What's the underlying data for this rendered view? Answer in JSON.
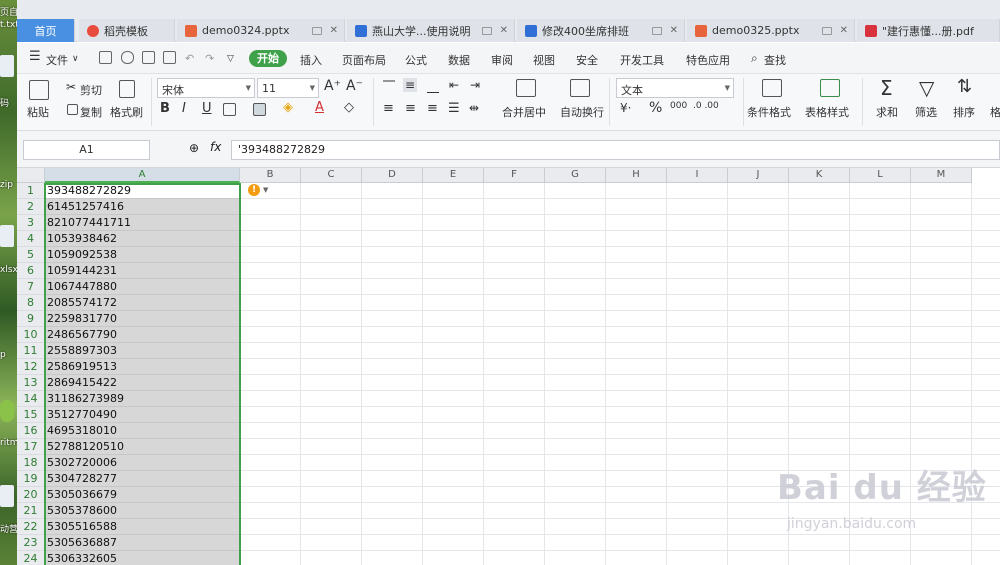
{
  "desktop": {
    "labels": [
      "页自",
      "t.txt",
      "码",
      "zip",
      "xlsx",
      "p",
      "ritm",
      "动营"
    ]
  },
  "tabs": [
    {
      "label": "首页",
      "active": true
    },
    {
      "label": "稻壳模板",
      "icon_color": "#e84c3d"
    },
    {
      "label": "demo0324.pptx",
      "icon_color": "#e8643c"
    },
    {
      "label": "燕山大学...使用说明",
      "icon_color": "#2f6fd6"
    },
    {
      "label": "修改400坐席排班",
      "icon_color": "#2f6fd6"
    },
    {
      "label": "demo0325.pptx",
      "icon_color": "#e8643c"
    },
    {
      "label": "\"建行惠懂...册.pdf",
      "icon_color": "#d8323c"
    }
  ],
  "menu": {
    "file_label": "文件",
    "start_label": "开始",
    "items": [
      "插入",
      "页面布局",
      "公式",
      "数据",
      "审阅",
      "视图",
      "安全",
      "开发工具",
      "特色应用"
    ],
    "search_label": "查找"
  },
  "ribbon": {
    "paste": "粘贴",
    "cut": "剪切",
    "copy": "复制",
    "format_painter": "格式刷",
    "font_name": "宋体",
    "font_size": "11",
    "merge_center": "合并居中",
    "wrap_text": "自动换行",
    "number_format": "文本",
    "conditional_format": "条件格式",
    "table_style": "表格样式",
    "sum": "求和",
    "filter": "筛选",
    "sort": "排序",
    "format": "格"
  },
  "formula_bar": {
    "name_box": "A1",
    "fx_label": "fx",
    "value": "'393488272829"
  },
  "columns": [
    "A",
    "B",
    "C",
    "D",
    "E",
    "F",
    "G",
    "H",
    "I",
    "J",
    "K",
    "L",
    "M"
  ],
  "rows": [
    {
      "n": "1",
      "a": "393488272829"
    },
    {
      "n": "2",
      "a": "61451257416"
    },
    {
      "n": "3",
      "a": "821077441711"
    },
    {
      "n": "4",
      "a": "1053938462"
    },
    {
      "n": "5",
      "a": "1059092538"
    },
    {
      "n": "6",
      "a": "1059144231"
    },
    {
      "n": "7",
      "a": "1067447880"
    },
    {
      "n": "8",
      "a": "2085574172"
    },
    {
      "n": "9",
      "a": "2259831770"
    },
    {
      "n": "10",
      "a": "2486567790"
    },
    {
      "n": "11",
      "a": "2558897303"
    },
    {
      "n": "12",
      "a": "2586919513"
    },
    {
      "n": "13",
      "a": "2869415422"
    },
    {
      "n": "14",
      "a": "31186273989"
    },
    {
      "n": "15",
      "a": "3512770490"
    },
    {
      "n": "16",
      "a": "4695318010"
    },
    {
      "n": "17",
      "a": "52788120510"
    },
    {
      "n": "18",
      "a": "5302720006"
    },
    {
      "n": "19",
      "a": "5304728277"
    },
    {
      "n": "20",
      "a": "5305036679"
    },
    {
      "n": "21",
      "a": "5305378600"
    },
    {
      "n": "22",
      "a": "5305516588"
    },
    {
      "n": "23",
      "a": "5305636887"
    },
    {
      "n": "24",
      "a": "5306332605"
    }
  ],
  "watermark": {
    "brand": "Bai du 经验",
    "url": "jingyan.baidu.com"
  },
  "colors": {
    "accent_green": "#3fa24a",
    "home_tab": "#4a90e2",
    "warning": "#f39c12"
  }
}
